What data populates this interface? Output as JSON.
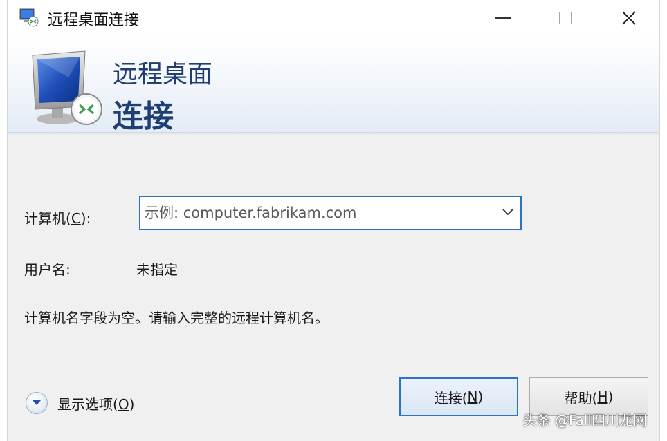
{
  "window": {
    "title": "远程桌面连接",
    "controls": {
      "minimize_icon": "minimize-icon",
      "maximize_icon": "maximize-icon",
      "close_icon": "close-icon"
    }
  },
  "banner": {
    "line1": "远程桌面",
    "line2": "连接",
    "icon": "remote-desktop-monitor-icon",
    "text_color": "#1f3f74"
  },
  "form": {
    "computer_label_prefix": "计算机(",
    "computer_label_mnemonic": "C",
    "computer_label_suffix": "):",
    "computer_input": {
      "value": "",
      "placeholder": "示例: computer.fabrikam.com"
    },
    "user_label": "用户名:",
    "user_value": "未指定",
    "message": "计算机名字段为空。请输入完整的远程计算机名。"
  },
  "footer": {
    "options_prefix": "显示选项(",
    "options_mnemonic": "O",
    "options_suffix": ")",
    "connect_prefix": "连接(",
    "connect_mnemonic": "N",
    "connect_suffix": ")",
    "help_prefix": "帮助(",
    "help_mnemonic": "H",
    "help_suffix": ")"
  },
  "watermark": "头条 @Fall四川龙网"
}
